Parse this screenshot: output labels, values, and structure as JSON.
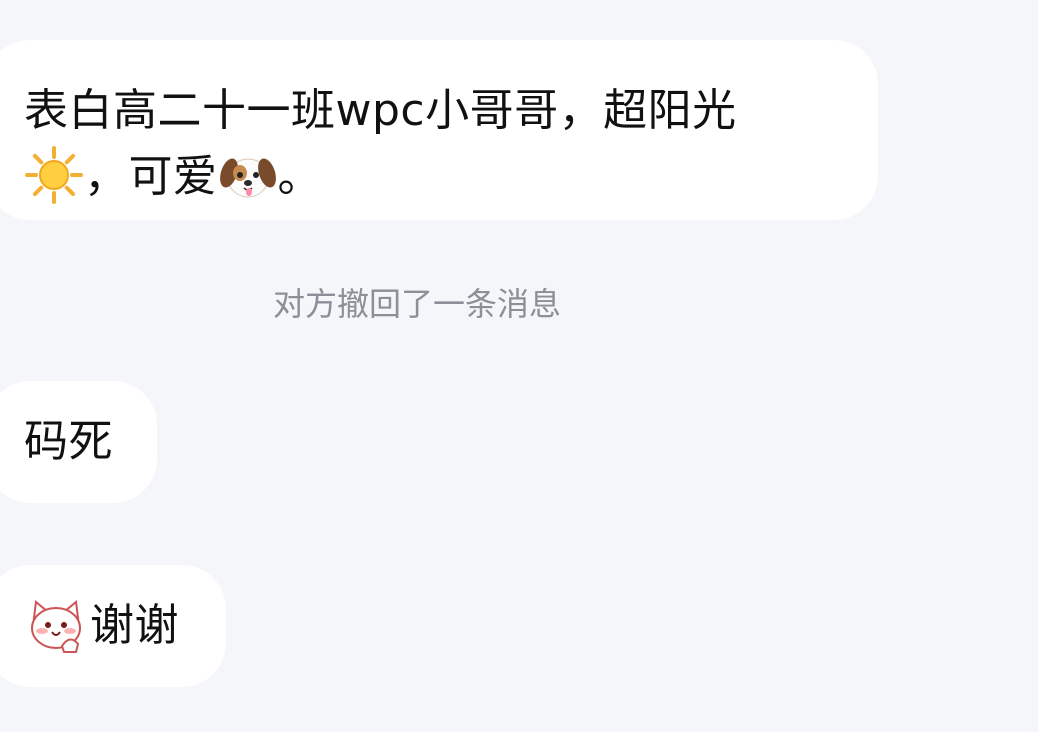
{
  "messages": [
    {
      "line1": "表白高二十一班wpc小哥哥，超阳光",
      "line2_part1": "，可爱",
      "line2_part2": "。",
      "emojis": [
        "sun-emoji",
        "dog-face-emoji"
      ]
    },
    {
      "text": "码死"
    },
    {
      "text": "谢谢",
      "emojis": [
        "cat-sticker"
      ]
    }
  ],
  "system_notice": "对方撤回了一条消息",
  "colors": {
    "background": "#f5f6fa",
    "bubble": "#ffffff",
    "text": "#111111",
    "notice_text": "#8c8f98"
  }
}
